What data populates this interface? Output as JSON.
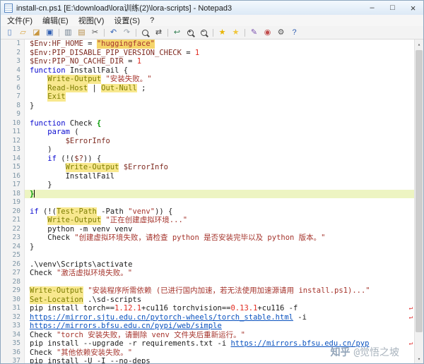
{
  "window": {
    "title": "install-cn.ps1 [E:\\download\\lora训练(2)\\lora-scripts] - Notepad3",
    "controls": {
      "minimize": "–",
      "maximize": "□",
      "close": "×"
    }
  },
  "menu": {
    "items": [
      {
        "id": "file",
        "label": "文件(F)"
      },
      {
        "id": "edit",
        "label": "编辑(E)"
      },
      {
        "id": "view",
        "label": "视图(V)"
      },
      {
        "id": "settings",
        "label": "设置(S)"
      },
      {
        "id": "help",
        "label": "?"
      }
    ]
  },
  "toolbar": {
    "items": [
      {
        "name": "new-file-button",
        "glyph": "▯",
        "color": "#4f7dc0"
      },
      {
        "name": "open-file-button",
        "glyph": "▱",
        "color": "#d9a33c"
      },
      {
        "name": "browse-files-button",
        "glyph": "◪",
        "color": "#c8963e"
      },
      {
        "name": "save-button",
        "glyph": "▣",
        "color": "#2f5fb3"
      },
      {
        "sep": true
      },
      {
        "name": "copy-button",
        "glyph": "▥",
        "color": "#6f7f8f"
      },
      {
        "name": "paste-button",
        "glyph": "▤",
        "color": "#b78e4a"
      },
      {
        "name": "cut-button",
        "glyph": "✂",
        "color": "#555555"
      },
      {
        "sep": true
      },
      {
        "name": "undo-button",
        "glyph": "↶",
        "color": "#2f5fb3"
      },
      {
        "name": "redo-button",
        "glyph": "↷",
        "color": "#98a2ac"
      },
      {
        "sep": true
      },
      {
        "name": "find-button",
        "kind": "mag",
        "color": "#444444"
      },
      {
        "name": "replace-button",
        "glyph": "⇄",
        "color": "#444444"
      },
      {
        "sep": true
      },
      {
        "name": "word-wrap-button",
        "glyph": "↩",
        "color": "#2f7d4f"
      },
      {
        "name": "zoom-in-button",
        "kind": "mag",
        "badge": "+",
        "color": "#444444"
      },
      {
        "name": "zoom-out-button",
        "kind": "mag",
        "badge": "−",
        "color": "#444444"
      },
      {
        "sep": true
      },
      {
        "name": "add-favorite-button",
        "glyph": "★",
        "color": "#e8b400"
      },
      {
        "name": "manage-favorites-button",
        "glyph": "★",
        "color": "#f0c63c"
      },
      {
        "sep": true
      },
      {
        "name": "scheme-config-button",
        "glyph": "✎",
        "color": "#7a4fb0"
      },
      {
        "name": "pin-on-top-button",
        "glyph": "◉",
        "color": "#c04b4b"
      },
      {
        "name": "settings-button",
        "glyph": "⚙",
        "color": "#555555"
      },
      {
        "name": "about-button",
        "glyph": "?",
        "color": "#2f5fb3"
      }
    ]
  },
  "scrollbar": {
    "up": "▴",
    "down": "▾"
  },
  "editor": {
    "wrap_marker": "↵",
    "current_line": 18,
    "lines": [
      {
        "n": 1,
        "seg": [
          [
            "v",
            "$Env:HF_HOME"
          ],
          [
            "t",
            " = "
          ],
          [
            "h",
            "\"huggingface\""
          ]
        ]
      },
      {
        "n": 2,
        "seg": [
          [
            "v",
            "$Env:PIP_DISABLE_PIP_VERSION_CHECK"
          ],
          [
            "t",
            " = "
          ],
          [
            "n",
            "1"
          ]
        ]
      },
      {
        "n": 3,
        "seg": [
          [
            "v",
            "$Env:PIP_NO_CACHE_DIR"
          ],
          [
            "t",
            " = "
          ],
          [
            "n",
            "1"
          ]
        ]
      },
      {
        "n": 4,
        "seg": [
          [
            "k",
            "function"
          ],
          [
            "t",
            " InstallFail {"
          ]
        ]
      },
      {
        "n": 5,
        "seg": [
          [
            "t",
            "    "
          ],
          [
            "c",
            "Write-Output"
          ],
          [
            "t",
            " "
          ],
          [
            "s",
            "\"安装失败。\""
          ]
        ]
      },
      {
        "n": 6,
        "seg": [
          [
            "t",
            "    "
          ],
          [
            "c",
            "Read-Host"
          ],
          [
            "t",
            " | "
          ],
          [
            "c",
            "Out-Null"
          ],
          [
            "t",
            " ;"
          ]
        ]
      },
      {
        "n": 7,
        "seg": [
          [
            "t",
            "    "
          ],
          [
            "c",
            "Exit"
          ]
        ]
      },
      {
        "n": 8,
        "seg": [
          [
            "t",
            "}"
          ]
        ]
      },
      {
        "n": 9,
        "seg": []
      },
      {
        "n": 10,
        "seg": [
          [
            "k",
            "function"
          ],
          [
            "t",
            " Check "
          ],
          [
            "b",
            "{"
          ]
        ]
      },
      {
        "n": 11,
        "seg": [
          [
            "t",
            "    "
          ],
          [
            "k",
            "param"
          ],
          [
            "t",
            " ("
          ]
        ]
      },
      {
        "n": 12,
        "seg": [
          [
            "t",
            "        "
          ],
          [
            "v",
            "$ErrorInfo"
          ]
        ]
      },
      {
        "n": 13,
        "seg": [
          [
            "t",
            "    )"
          ]
        ]
      },
      {
        "n": 14,
        "seg": [
          [
            "t",
            "    "
          ],
          [
            "k",
            "if"
          ],
          [
            "t",
            " (!("
          ],
          [
            "v",
            "$?"
          ],
          [
            "t",
            ")) {"
          ]
        ]
      },
      {
        "n": 15,
        "seg": [
          [
            "t",
            "        "
          ],
          [
            "c",
            "Write-Output"
          ],
          [
            "t",
            " "
          ],
          [
            "v",
            "$ErrorInfo"
          ]
        ]
      },
      {
        "n": 16,
        "seg": [
          [
            "t",
            "        InstallFail"
          ]
        ]
      },
      {
        "n": 17,
        "seg": [
          [
            "t",
            "    }"
          ]
        ]
      },
      {
        "n": 18,
        "seg": [
          [
            "b",
            "}"
          ]
        ],
        "cur": true
      },
      {
        "n": 19,
        "seg": []
      },
      {
        "n": 20,
        "seg": [
          [
            "k",
            "if"
          ],
          [
            "t",
            " (!("
          ],
          [
            "c",
            "Test-Path"
          ],
          [
            "t",
            " -Path "
          ],
          [
            "s",
            "\"venv\""
          ],
          [
            "t",
            ")) {"
          ]
        ]
      },
      {
        "n": 21,
        "seg": [
          [
            "t",
            "    "
          ],
          [
            "c",
            "Write-Output"
          ],
          [
            "t",
            " "
          ],
          [
            "s",
            "\"正在创建虚拟环境...\""
          ]
        ]
      },
      {
        "n": 22,
        "seg": [
          [
            "t",
            "    python -m venv venv"
          ]
        ]
      },
      {
        "n": 23,
        "seg": [
          [
            "t",
            "    Check "
          ],
          [
            "s",
            "\"创建虚拟环境失败，请检查 python 是否安装完毕以及 python 版本。\""
          ]
        ]
      },
      {
        "n": 24,
        "seg": [
          [
            "t",
            "}"
          ]
        ]
      },
      {
        "n": 25,
        "seg": []
      },
      {
        "n": 26,
        "seg": [
          [
            "t",
            ".\\venv\\Scripts\\activate"
          ]
        ]
      },
      {
        "n": 27,
        "seg": [
          [
            "t",
            "Check "
          ],
          [
            "s",
            "\"激活虚拟环境失败。\""
          ]
        ]
      },
      {
        "n": 28,
        "seg": []
      },
      {
        "n": 29,
        "seg": [
          [
            "c",
            "Write-Output"
          ],
          [
            "t",
            " "
          ],
          [
            "s",
            "\"安装程序所需依赖 (已进行国内加速，若无法使用加速源请用 install.ps1)...\""
          ]
        ]
      },
      {
        "n": 30,
        "seg": [
          [
            "c",
            "Set-Location"
          ],
          [
            "t",
            " .\\sd-scripts"
          ]
        ]
      },
      {
        "n": 31,
        "seg": [
          [
            "t",
            "pip install torch=="
          ],
          [
            "n",
            "1.12.1"
          ],
          [
            "t",
            "+cu116 torchvision=="
          ],
          [
            "n",
            "0.13.1"
          ],
          [
            "t",
            "+cu116 -f"
          ]
        ],
        "wrap": true
      },
      {
        "n": 32,
        "seg": [
          [
            "u",
            "https://mirror.sjtu.edu.cn/pytorch-wheels/torch_stable.html"
          ],
          [
            "t",
            " -i"
          ]
        ],
        "wrap": true
      },
      {
        "n": 33,
        "seg": [
          [
            "u",
            "https://mirrors.bfsu.edu.cn/pypi/web/simple"
          ]
        ]
      },
      {
        "n": 34,
        "seg": [
          [
            "t",
            "Check "
          ],
          [
            "s",
            "\"torch 安装失败，请删除 venv 文件夹后重新运行。\""
          ]
        ]
      },
      {
        "n": 35,
        "seg": [
          [
            "t",
            "pip install --upgrade -r requirements.txt -i "
          ],
          [
            "u",
            "https://mirrors.bfsu.edu.cn/pyp"
          ]
        ],
        "wrap": true
      },
      {
        "n": 36,
        "seg": [
          [
            "t",
            "Check "
          ],
          [
            "s",
            "\"其他依赖安装失败。\""
          ]
        ]
      },
      {
        "n": 37,
        "seg": [
          [
            "t",
            "pip install -U -I --no-deps"
          ]
        ]
      }
    ]
  },
  "watermark": {
    "brand": "知乎",
    "handle": "@觉悟之坡"
  }
}
